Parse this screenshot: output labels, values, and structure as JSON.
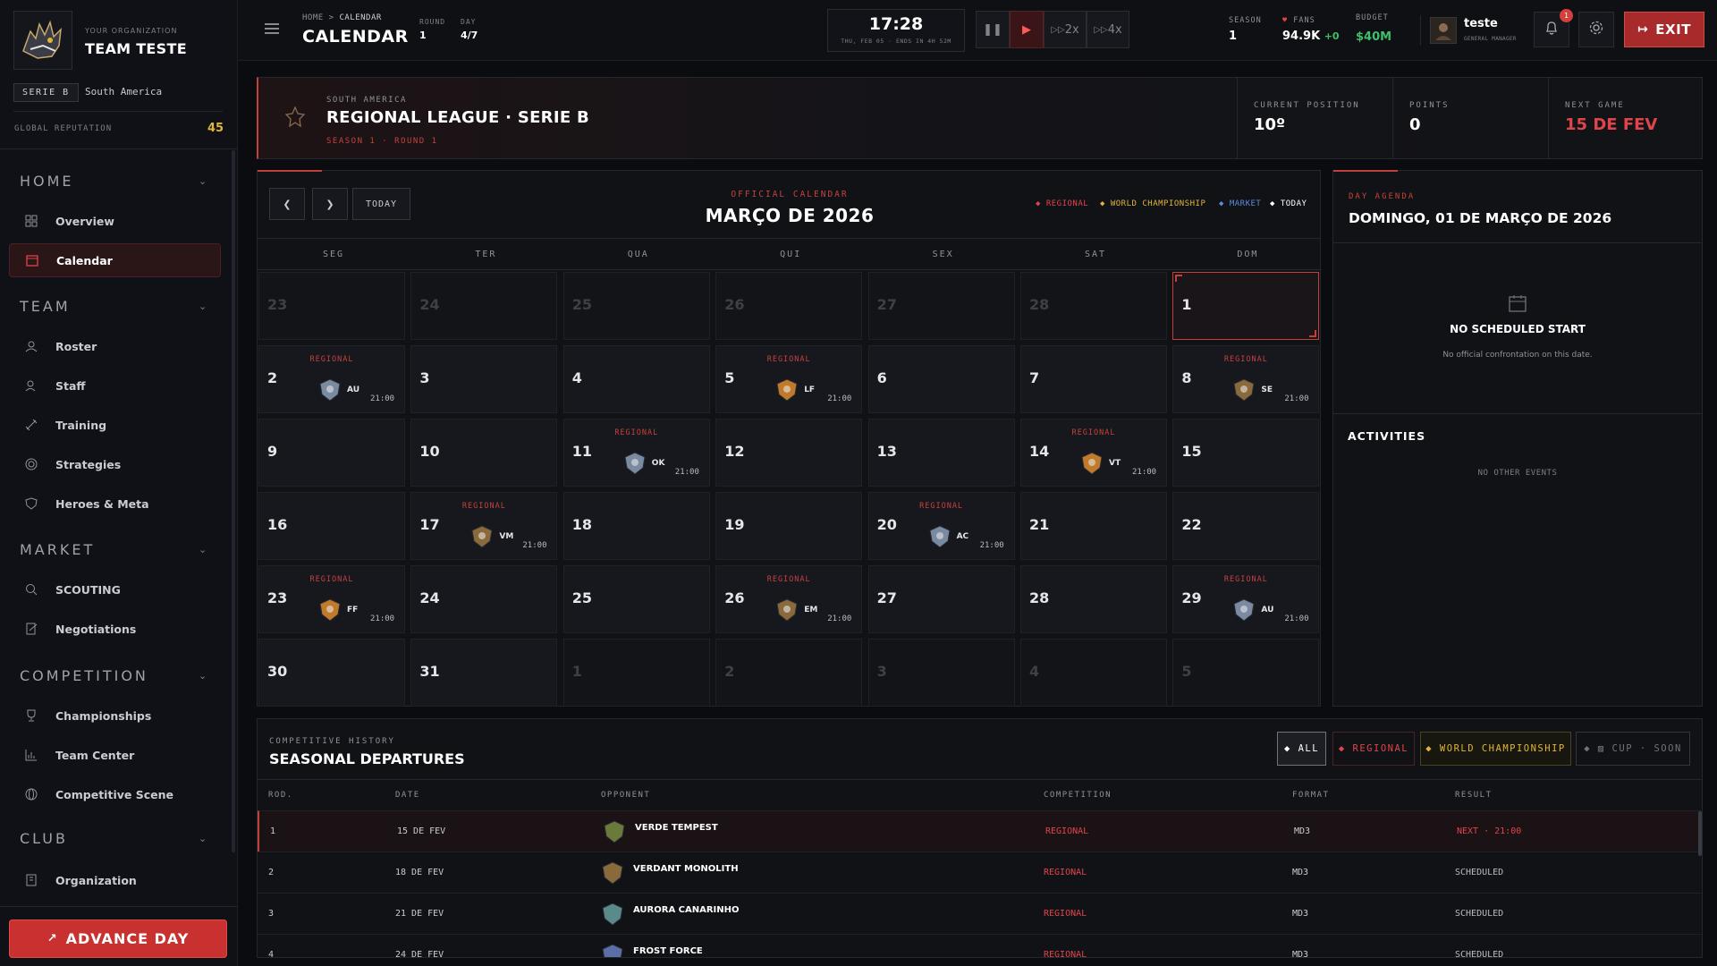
{
  "org": {
    "caption": "YOUR ORGANIZATION",
    "name": "TEAM TESTE",
    "league_tag": "SERIE B",
    "region": "South America",
    "reputation_label": "GLOBAL REPUTATION",
    "reputation_value": "45"
  },
  "sidebar": {
    "sections": {
      "home": "HOME",
      "team": "TEAM",
      "market": "MARKET",
      "competition": "COMPETITION",
      "club": "CLUB"
    },
    "items": {
      "overview": "Overview",
      "calendar": "Calendar",
      "roster": "Roster",
      "staff": "Staff",
      "training": "Training",
      "strategies": "Strategies",
      "heroes": "Heroes & Meta",
      "scouting": "SCOUTING",
      "negotiations": "Negotiations",
      "championships": "Championships",
      "team_center": "Team Center",
      "competitive_scene": "Competitive Scene",
      "organization": "Organization"
    },
    "advance_label": "ADVANCE DAY"
  },
  "topbar": {
    "crumb_home": "HOME",
    "crumb_sep": ">",
    "crumb_current": "CALENDAR",
    "title": "CALENDAR",
    "round_label": "ROUND",
    "round_value": "1",
    "day_label": "DAY",
    "day_value": "4/7",
    "clock": "17:28",
    "clock_sub": "THU, FEB 05 · ENDS IN 4H 52M",
    "speed_2x": "2x",
    "speed_4x": "4x",
    "season_label": "SEASON",
    "season_value": "1",
    "fans_label": "FANS",
    "fans_value": "94.9K",
    "fans_delta": "+0",
    "budget_label": "BUDGET",
    "budget_value": "$40M",
    "user_name": "teste",
    "user_role": "GENERAL MANAGER",
    "notif_count": "1",
    "exit_label": "EXIT"
  },
  "league": {
    "region": "SOUTH AMERICA",
    "title": "REGIONAL LEAGUE · SERIE B",
    "subtitle": "SEASON 1 · ROUND 1",
    "position_label": "CURRENT POSITION",
    "position_value": "10º",
    "points_label": "POINTS",
    "points_value": "0",
    "next_label": "NEXT GAME",
    "next_value": "15 DE FEV"
  },
  "calendar": {
    "today_label": "TODAY",
    "caption": "OFFICIAL CALENDAR",
    "month": "MARÇO DE 2026",
    "legend": [
      "REGIONAL",
      "WORLD CHAMPIONSHIP",
      "MARKET",
      "TODAY"
    ],
    "weekdays": [
      "SEG",
      "TER",
      "QUA",
      "QUI",
      "SEX",
      "SAT",
      "DOM"
    ],
    "cells": [
      {
        "d": "23",
        "dim": true
      },
      {
        "d": "24",
        "dim": true
      },
      {
        "d": "25",
        "dim": true
      },
      {
        "d": "26",
        "dim": true
      },
      {
        "d": "27",
        "dim": true
      },
      {
        "d": "28",
        "dim": true
      },
      {
        "d": "1",
        "today": true
      },
      {
        "d": "2",
        "ev": "REGIONAL",
        "opp": "AU",
        "t": "21:00"
      },
      {
        "d": "3"
      },
      {
        "d": "4"
      },
      {
        "d": "5",
        "ev": "REGIONAL",
        "opp": "LF",
        "t": "21:00"
      },
      {
        "d": "6"
      },
      {
        "d": "7"
      },
      {
        "d": "8",
        "ev": "REGIONAL",
        "opp": "SE",
        "t": "21:00"
      },
      {
        "d": "9"
      },
      {
        "d": "10"
      },
      {
        "d": "11",
        "ev": "REGIONAL",
        "opp": "OK",
        "t": "21:00"
      },
      {
        "d": "12"
      },
      {
        "d": "13"
      },
      {
        "d": "14",
        "ev": "REGIONAL",
        "opp": "VT",
        "t": "21:00"
      },
      {
        "d": "15"
      },
      {
        "d": "16"
      },
      {
        "d": "17",
        "ev": "REGIONAL",
        "opp": "VM",
        "t": "21:00"
      },
      {
        "d": "18"
      },
      {
        "d": "19"
      },
      {
        "d": "20",
        "ev": "REGIONAL",
        "opp": "AC",
        "t": "21:00"
      },
      {
        "d": "21"
      },
      {
        "d": "22"
      },
      {
        "d": "23",
        "ev": "REGIONAL",
        "opp": "FF",
        "t": "21:00"
      },
      {
        "d": "24"
      },
      {
        "d": "25"
      },
      {
        "d": "26",
        "ev": "REGIONAL",
        "opp": "EM",
        "t": "21:00"
      },
      {
        "d": "27"
      },
      {
        "d": "28"
      },
      {
        "d": "29",
        "ev": "REGIONAL",
        "opp": "AU",
        "t": "21:00"
      },
      {
        "d": "30"
      },
      {
        "d": "31"
      },
      {
        "d": "1",
        "dim": true
      },
      {
        "d": "2",
        "dim": true
      },
      {
        "d": "3",
        "dim": true
      },
      {
        "d": "4",
        "dim": true
      },
      {
        "d": "5",
        "dim": true
      }
    ]
  },
  "agenda": {
    "caption": "DAY AGENDA",
    "date": "DOMINGO, 01 DE MARÇO DE 2026",
    "empty_title": "NO SCHEDULED START",
    "empty_sub": "No official confrontation on this date.",
    "activities_label": "ACTIVITIES",
    "activities_empty": "NO OTHER EVENTS"
  },
  "history": {
    "caption": "COMPETITIVE HISTORY",
    "title": "SEASONAL DEPARTURES",
    "filters": {
      "all": "ALL",
      "regional": "REGIONAL",
      "world": "WORLD CHAMPIONSHIP",
      "cup": "CUP · SOON"
    },
    "columns": [
      "ROD.",
      "DATE",
      "OPPONENT",
      "COMPETITION",
      "FORMAT",
      "RESULT"
    ],
    "rows": [
      {
        "rod": "1",
        "date": "15 DE FEV",
        "opp": "VERDE TEMPEST",
        "comp": "REGIONAL",
        "fmt": "MD3",
        "res": "NEXT · 21:00"
      },
      {
        "rod": "2",
        "date": "18 DE FEV",
        "opp": "VERDANT MONOLITH",
        "comp": "REGIONAL",
        "fmt": "MD3",
        "res": "SCHEDULED"
      },
      {
        "rod": "3",
        "date": "21 DE FEV",
        "opp": "AURORA CANARINHO",
        "comp": "REGIONAL",
        "fmt": "MD3",
        "res": "SCHEDULED"
      },
      {
        "rod": "4",
        "date": "24 DE FEV",
        "opp": "FROST FORCE",
        "comp": "REGIONAL",
        "fmt": "MD3",
        "res": "SCHEDULED"
      }
    ]
  },
  "colors": {
    "accent": "#c2403c",
    "regional": "#e0444a",
    "world": "#e0b53a",
    "market": "#5b8de0",
    "today": "#ffffff",
    "budget": "#3fbf6a"
  }
}
